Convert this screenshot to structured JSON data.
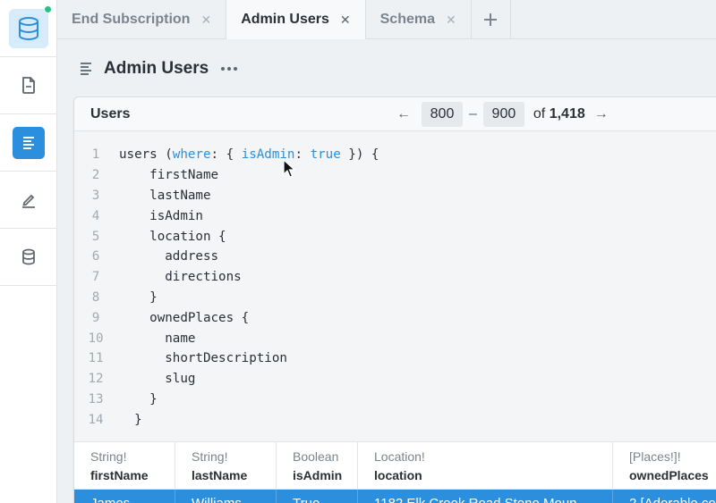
{
  "sidebar": {
    "items": [
      {
        "icon": "database-icon",
        "active": false
      },
      {
        "icon": "document-icon"
      },
      {
        "icon": "list-icon",
        "active": true
      },
      {
        "icon": "edit-icon"
      },
      {
        "icon": "database-icon"
      }
    ],
    "status_color": "#26c281"
  },
  "tabs": [
    {
      "label": "End Subscription",
      "close": "✕"
    },
    {
      "label": "Admin Users",
      "close": "✕"
    },
    {
      "label": "Schema",
      "close": "✕"
    }
  ],
  "add_tab": "+",
  "page": {
    "title": "Admin Users"
  },
  "card": {
    "title": "Users",
    "pager": {
      "prev": "←",
      "from": "800",
      "sep": "–",
      "to": "900",
      "of_label": "of",
      "total": "1,418",
      "next": "→"
    }
  },
  "code": {
    "lines": [
      {
        "n": "1",
        "text": "users (where: { isAdmin: true }) {"
      },
      {
        "n": "2",
        "text": "    firstName"
      },
      {
        "n": "3",
        "text": "    lastName"
      },
      {
        "n": "4",
        "text": "    isAdmin"
      },
      {
        "n": "5",
        "text": "    location {"
      },
      {
        "n": "6",
        "text": "      address"
      },
      {
        "n": "7",
        "text": "      directions"
      },
      {
        "n": "8",
        "text": "    }"
      },
      {
        "n": "9",
        "text": "    ownedPlaces {"
      },
      {
        "n": "10",
        "text": "      name"
      },
      {
        "n": "11",
        "text": "      shortDescription"
      },
      {
        "n": "12",
        "text": "      slug"
      },
      {
        "n": "13",
        "text": "    }"
      },
      {
        "n": "14",
        "text": "  }"
      }
    ],
    "keyword_color": "#2b8fde"
  },
  "table": {
    "columns": [
      {
        "type": "String!",
        "name": "firstName"
      },
      {
        "type": "String!",
        "name": "lastName"
      },
      {
        "type": "Boolean",
        "name": "isAdmin"
      },
      {
        "type": "Location!",
        "name": "location"
      },
      {
        "type": "[Places!]!",
        "name": "ownedPlaces"
      }
    ],
    "rows": [
      [
        "James",
        "Williams",
        "True",
        "1182 Elk Creek Road Stone Moun",
        "2 [Adorable cot"
      ]
    ],
    "selected_row_color": "#2b8fde"
  }
}
